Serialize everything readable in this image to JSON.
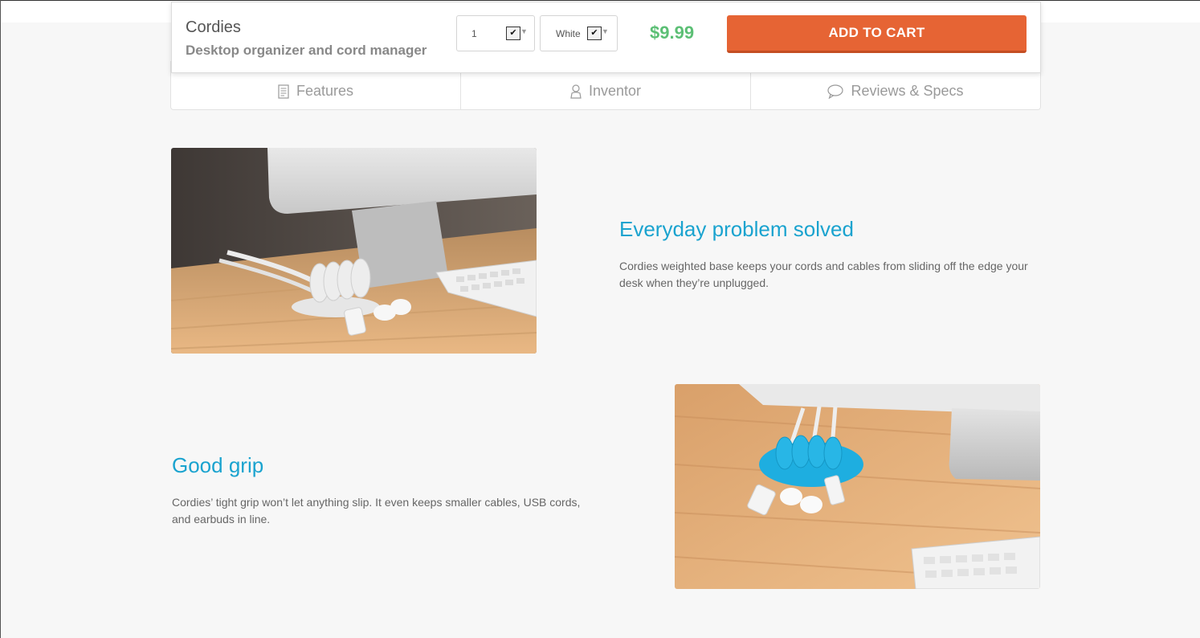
{
  "buybar": {
    "product_name": "Cordies",
    "product_subtitle": "Desktop organizer and cord manager",
    "quantity": {
      "selected": "1"
    },
    "color": {
      "selected": "White"
    },
    "price": "$9.99",
    "add_to_cart_label": "ADD TO CART",
    "accent_color": "#e66434",
    "price_color": "#5cbf75"
  },
  "tabs": [
    {
      "label": "Features",
      "icon": "document-list-icon"
    },
    {
      "label": "Inventor",
      "icon": "person-icon"
    },
    {
      "label": "Reviews & Specs",
      "icon": "speech-bubble-icon"
    }
  ],
  "features": [
    {
      "title": "Everyday problem solved",
      "text": "Cordies weighted base keeps your cords and cables from sliding off the edge your desk when they’re unplugged."
    },
    {
      "title": "Good grip",
      "text": "Cordies’ tight grip won’t let anything slip. It even keeps smaller cables, USB cords, and earbuds in line."
    }
  ],
  "colors": {
    "heading": "#1aa3cf",
    "background": "#f7f7f7"
  }
}
